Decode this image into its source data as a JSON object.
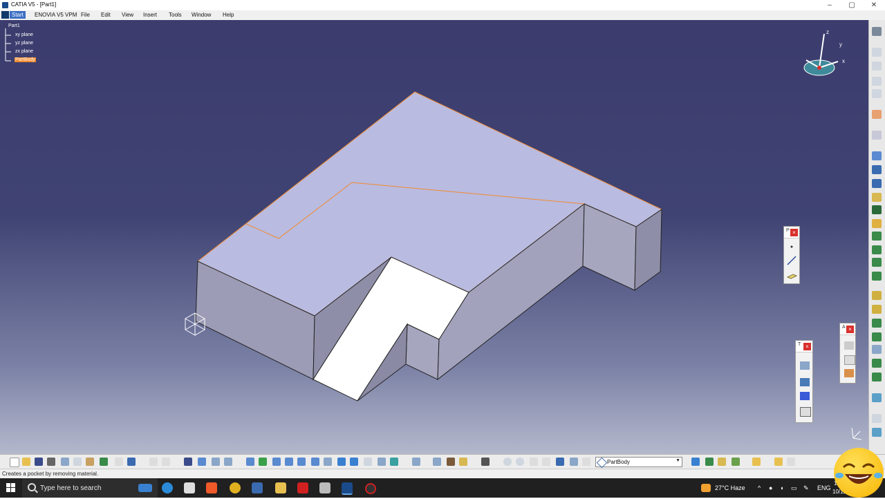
{
  "window": {
    "title": "CATIA V5 - [Part1]",
    "controls": [
      "–",
      "▢",
      "✕"
    ]
  },
  "menu": {
    "items": [
      "Start",
      "ENOVIA V5 VPM",
      "File",
      "Edit",
      "View",
      "Insert",
      "Tools",
      "Window",
      "Help"
    ]
  },
  "tree": {
    "root": "Part1",
    "planes": [
      "xy plane",
      "yz plane",
      "zx plane"
    ],
    "body": "PartBody"
  },
  "compass": {
    "axes": [
      "x",
      "y",
      "z"
    ]
  },
  "float_toolbars": [
    {
      "label": "P"
    },
    {
      "label": "A"
    },
    {
      "label": "T"
    }
  ],
  "bottom_toolbar": {
    "current_body": "PartBody"
  },
  "status": {
    "message": "Creates a pocket by removing material."
  },
  "taskbar": {
    "search_placeholder": "Type here to search",
    "weather": "27°C  Haze",
    "language": "ENG",
    "time": "10:",
    "date": "10/11/2"
  },
  "colors": {
    "viewport_top": "#3c3c6e",
    "part_face_top": "#b9bbe0",
    "part_face_side": "#9c9cb6",
    "pocket_face": "#ffffff",
    "highlight": "#f38a2e"
  }
}
